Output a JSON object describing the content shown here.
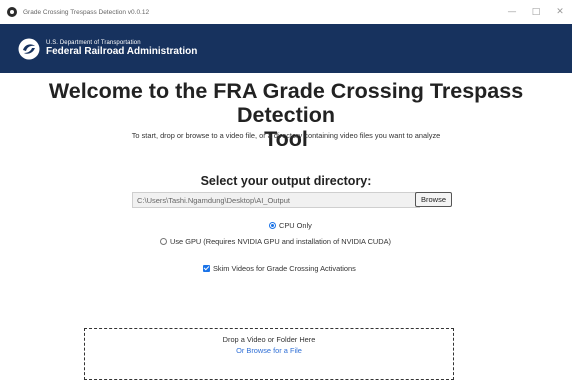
{
  "window": {
    "title": "Grade Crossing Trespass Detection v0.0.12",
    "minimize_icon": "minimize-icon",
    "maximize_icon": "maximize-icon",
    "close_icon": "close-icon"
  },
  "header": {
    "department": "U.S. Department of Transportation",
    "agency": "Federal Railroad Administration",
    "logo_icon": "dot-logo-icon",
    "background": "#17325e"
  },
  "main": {
    "welcome_line1": "Welcome to the FRA Grade Crossing Trespass Detection",
    "welcome_line2": "Tool",
    "subtitle": "To start, drop or browse to a video file, or a directory containing video files you want to analyze",
    "output_heading": "Select your output directory:",
    "output_directory": "C:\\Users\\Tashi.Ngamdung\\Desktop\\AI_Output",
    "browse_label": "Browse",
    "processing_options": [
      {
        "label": "CPU Only",
        "selected": true
      },
      {
        "label": "Use GPU (Requires NVIDIA GPU and installation of NVIDIA CUDA)",
        "selected": false
      }
    ],
    "skim_label": "Skim Videos for Grade Crossing Activations",
    "skim_checked": true,
    "dropzone_text": "Drop a Video or Folder Here",
    "dropzone_link": "Or Browse for a File",
    "accent_color": "#1a73e8",
    "link_color": "#2f6fd6"
  }
}
